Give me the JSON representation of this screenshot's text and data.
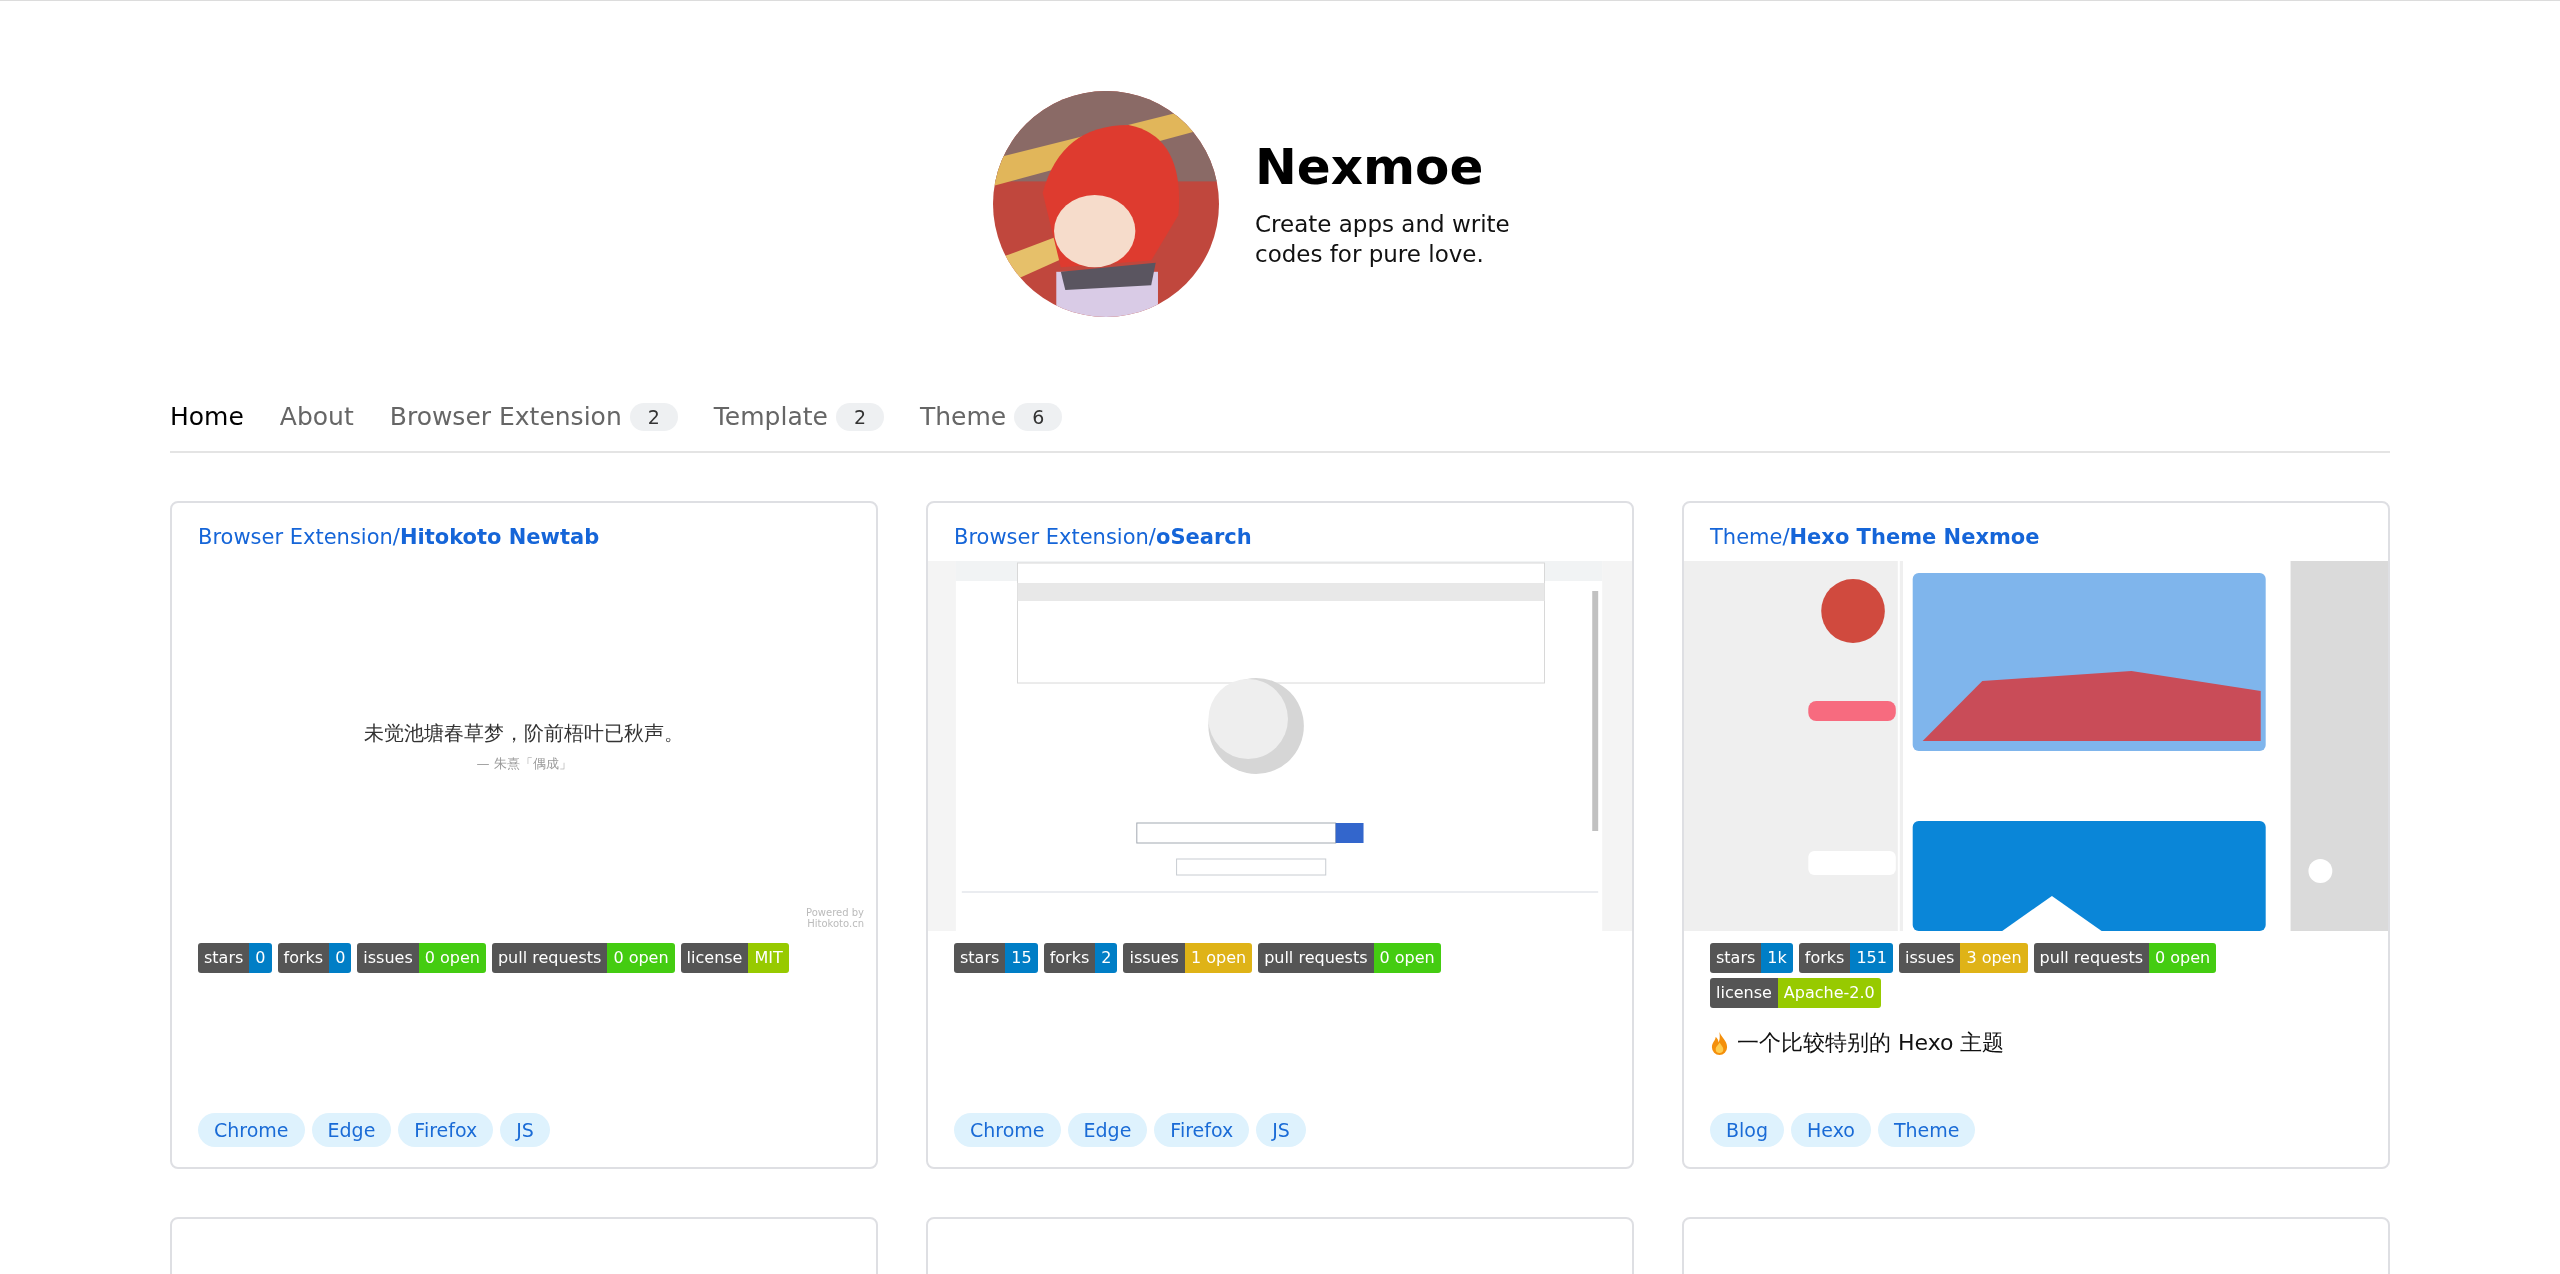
{
  "profile": {
    "name": "Nexmoe",
    "bio": "Create apps and write codes for pure love."
  },
  "nav": [
    {
      "label": "Home",
      "selected": true
    },
    {
      "label": "About",
      "selected": false
    },
    {
      "label": "Browser Extension",
      "count": "2",
      "selected": false
    },
    {
      "label": "Template",
      "count": "2",
      "selected": false
    },
    {
      "label": "Theme",
      "count": "6",
      "selected": false
    }
  ],
  "cards": [
    {
      "category": "Browser Extension/",
      "name": "Hitokoto Newtab",
      "preview": {
        "kind": "quote",
        "quote": "未觉池塘春草梦，阶前梧叶已秋声。",
        "source": "— 朱熹「偶成」",
        "credit": "Powered by Hitokoto.cn"
      },
      "badges": [
        {
          "label": "stars",
          "value": "0",
          "color": "#007ec6"
        },
        {
          "label": "forks",
          "value": "0",
          "color": "#007ec6"
        },
        {
          "label": "issues",
          "value": "0 open",
          "color": "#44cc11"
        },
        {
          "label": "pull requests",
          "value": "0 open",
          "color": "#44cc11"
        },
        {
          "label": "license",
          "value": "MIT",
          "color": "#97ca00"
        }
      ],
      "tags": [
        "Chrome",
        "Edge",
        "Firefox",
        "JS"
      ]
    },
    {
      "category": "Browser Extension/",
      "name": "oSearch",
      "preview": {
        "kind": "browser"
      },
      "badges": [
        {
          "label": "stars",
          "value": "15",
          "color": "#007ec6"
        },
        {
          "label": "forks",
          "value": "2",
          "color": "#007ec6"
        },
        {
          "label": "issues",
          "value": "1 open",
          "color": "#dfb317"
        },
        {
          "label": "pull requests",
          "value": "0 open",
          "color": "#44cc11"
        }
      ],
      "tags": [
        "Chrome",
        "Edge",
        "Firefox",
        "JS"
      ]
    },
    {
      "category": "Theme/",
      "name": "Hexo Theme Nexmoe",
      "preview": {
        "kind": "blog"
      },
      "badges": [
        {
          "label": "stars",
          "value": "1k",
          "color": "#007ec6"
        },
        {
          "label": "forks",
          "value": "151",
          "color": "#007ec6"
        },
        {
          "label": "issues",
          "value": "3 open",
          "color": "#dfb317"
        },
        {
          "label": "pull requests",
          "value": "0 open",
          "color": "#44cc11"
        },
        {
          "label": "license",
          "value": "Apache-2.0",
          "color": "#97ca00"
        }
      ],
      "description": "一个比较特别的 Hexo 主题",
      "tags": [
        "Blog",
        "Hexo",
        "Theme"
      ]
    }
  ]
}
